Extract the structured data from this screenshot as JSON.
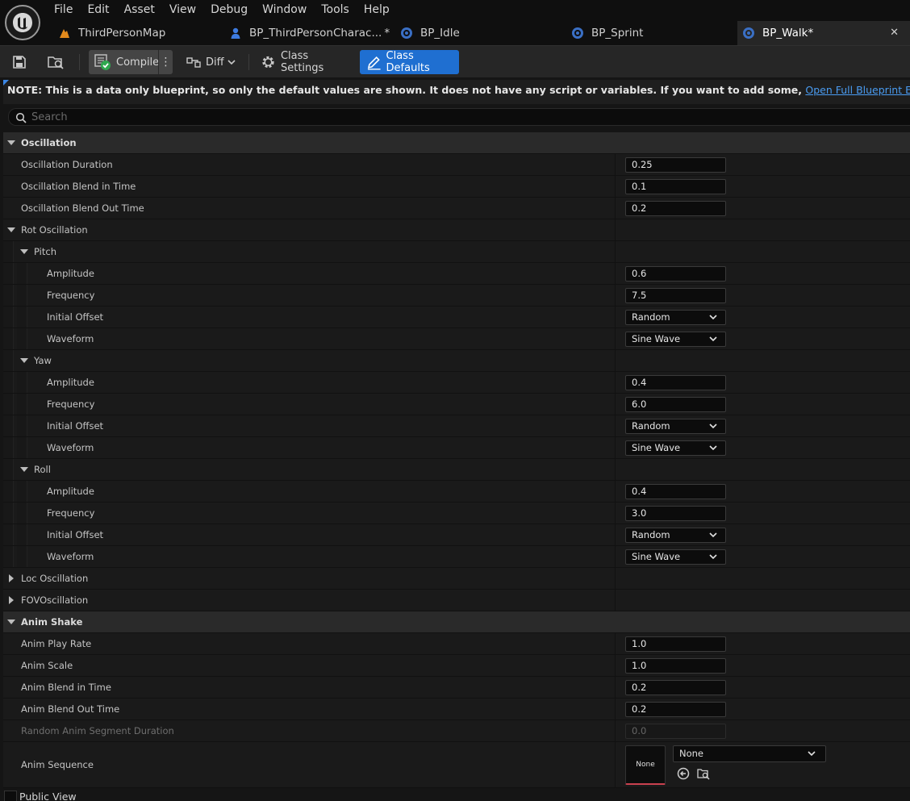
{
  "menu": [
    "File",
    "Edit",
    "Asset",
    "View",
    "Debug",
    "Window",
    "Tools",
    "Help"
  ],
  "tabs": [
    {
      "label": "ThirdPersonMap",
      "icon": "level-icon"
    },
    {
      "label": "BP_ThirdPersonCharac...",
      "icon": "character-icon",
      "modified": "*"
    },
    {
      "label": "BP_Idle",
      "icon": "blueprint-icon"
    },
    {
      "label": "BP_Sprint",
      "icon": "blueprint-icon"
    },
    {
      "label": "BP_Walk*",
      "icon": "blueprint-icon",
      "active": true
    }
  ],
  "toolbar": {
    "compile_label": "Compile",
    "diff_label": "Diff",
    "class_settings_label": "Class Settings",
    "class_defaults_label": "Class Defaults"
  },
  "note": {
    "text": "NOTE: This is a data only blueprint, so only the default values are shown.  It does not have any script or variables.  If you want to add some, ",
    "link": "Open Full Blueprint Editor"
  },
  "search": {
    "placeholder": "Search"
  },
  "oscillation": {
    "title": "Oscillation",
    "duration_label": "Oscillation Duration",
    "duration": "0.25",
    "blend_in_label": "Oscillation Blend in Time",
    "blend_in": "0.1",
    "blend_out_label": "Oscillation Blend Out Time",
    "blend_out": "0.2",
    "rot_label": "Rot Oscillation",
    "loc_label": "Loc Oscillation",
    "fov_label": "FOVOscillation"
  },
  "labels": {
    "amplitude": "Amplitude",
    "frequency": "Frequency",
    "initial_offset": "Initial Offset",
    "waveform": "Waveform"
  },
  "pitch": {
    "title": "Pitch",
    "amplitude": "0.6",
    "frequency": "7.5",
    "initial_offset": "Random",
    "waveform": "Sine Wave"
  },
  "yaw": {
    "title": "Yaw",
    "amplitude": "0.4",
    "frequency": "6.0",
    "initial_offset": "Random",
    "waveform": "Sine Wave"
  },
  "roll": {
    "title": "Roll",
    "amplitude": "0.4",
    "frequency": "3.0",
    "initial_offset": "Random",
    "waveform": "Sine Wave"
  },
  "anim_shake": {
    "title": "Anim Shake",
    "play_rate_label": "Anim Play Rate",
    "play_rate": "1.0",
    "scale_label": "Anim Scale",
    "scale": "1.0",
    "blend_in_label": "Anim Blend in Time",
    "blend_in": "0.2",
    "blend_out_label": "Anim Blend Out Time",
    "blend_out": "0.2",
    "segment_label": "Random Anim Segment Duration",
    "segment": "0.0",
    "sequence_label": "Anim Sequence",
    "sequence_thumb": "None",
    "sequence_value": "None"
  },
  "bottom": {
    "public_view_label": "Public View"
  },
  "colors": {
    "accent": "#1f6fd1",
    "link": "#4a9cf2",
    "thumb_underline": "#c9414f"
  }
}
